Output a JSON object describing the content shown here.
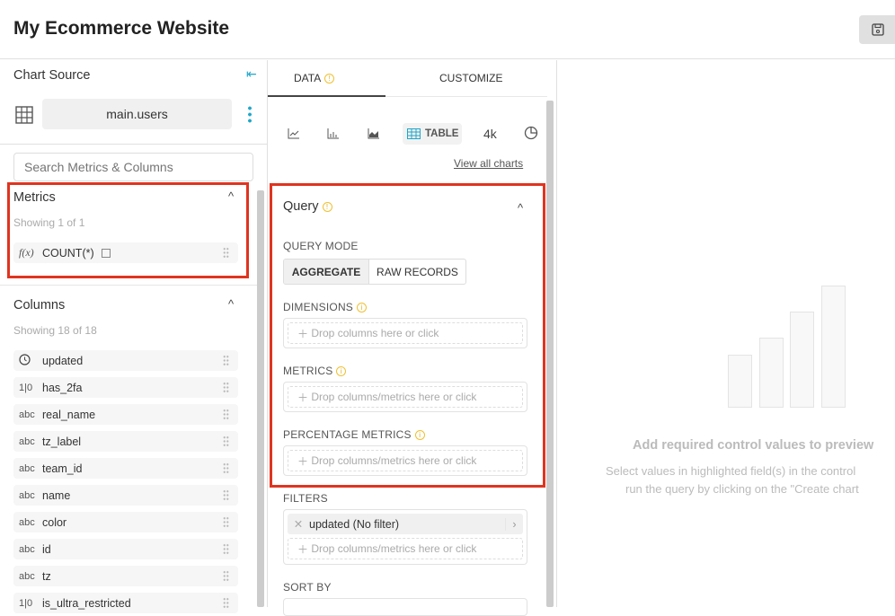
{
  "header": {
    "title": "My Ecommerce Website",
    "save_icon": "floppy-disk-icon"
  },
  "left": {
    "chart_source_label": "Chart Source",
    "dataset": "main.users",
    "search_placeholder": "Search Metrics & Columns",
    "metrics": {
      "title": "Metrics",
      "showing": "Showing 1 of 1",
      "items": [
        {
          "icon": "f(x)",
          "name": "COUNT(*)"
        }
      ]
    },
    "columns": {
      "title": "Columns",
      "showing": "Showing 18 of 18",
      "items": [
        {
          "type": "clock",
          "name": "updated"
        },
        {
          "type": "1|0",
          "name": "has_2fa"
        },
        {
          "type": "abc",
          "name": "real_name"
        },
        {
          "type": "abc",
          "name": "tz_label"
        },
        {
          "type": "abc",
          "name": "team_id"
        },
        {
          "type": "abc",
          "name": "name"
        },
        {
          "type": "abc",
          "name": "color"
        },
        {
          "type": "abc",
          "name": "id"
        },
        {
          "type": "abc",
          "name": "tz"
        },
        {
          "type": "1|0",
          "name": "is_ultra_restricted"
        }
      ]
    }
  },
  "middle": {
    "tabs": [
      {
        "label": "DATA",
        "active": true
      },
      {
        "label": "CUSTOMIZE",
        "active": false
      }
    ],
    "chart_types": {
      "table_label": "TABLE",
      "bignum_label": "4k",
      "view_all": "View all charts"
    },
    "query": {
      "title": "Query",
      "mode_label": "QUERY MODE",
      "modes": [
        "AGGREGATE",
        "RAW RECORDS"
      ],
      "active_mode": "AGGREGATE",
      "dimensions_label": "DIMENSIONS",
      "dimensions_placeholder": "Drop columns here or click",
      "metrics_label": "METRICS",
      "metrics_placeholder": "Drop columns/metrics here or click",
      "pct_label": "PERCENTAGE METRICS",
      "pct_placeholder": "Drop columns/metrics here or click"
    },
    "filters": {
      "label": "FILTERS",
      "items": [
        "updated (No filter)"
      ],
      "placeholder": "Drop columns/metrics here or click"
    },
    "sort_label": "SORT BY"
  },
  "preview": {
    "title": "Add required control values to preview",
    "line1": "Select values in highlighted field(s) in the control",
    "line2": "run the query by clicking on the \"Create chart"
  },
  "colors": {
    "highlight": "#e0341f",
    "accent": "#20a7c9",
    "warning": "#f0c030"
  }
}
